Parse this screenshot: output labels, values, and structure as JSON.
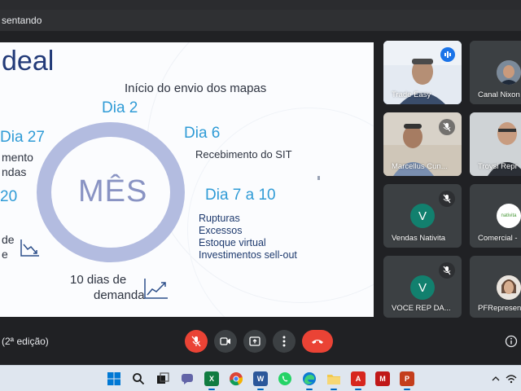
{
  "window": {
    "presenting_label": "sentando"
  },
  "slide": {
    "title": "deal",
    "circle_label": "MÊS",
    "items": {
      "dia2_label": "Dia 2",
      "dia2_text": "Início do envio dos mapas",
      "dia6_label": "Dia 6",
      "dia6_text": "Recebimento do SIT",
      "dia7_label": "Dia 7 a 10",
      "dia7_lines": [
        "Rupturas",
        "Excessos",
        "Estoque virtual",
        "Investimentos sell-out"
      ],
      "dia27_label": "Dia 27",
      "left_line1": "mento",
      "left_line2": "ndas",
      "left_day20": "20",
      "left_line3": "de",
      "left_line4": "e",
      "bottom_line1": "10 dias de",
      "bottom_line2": "demanda"
    }
  },
  "participants": [
    {
      "name": "Trade Easy",
      "speaking": true,
      "muted": false
    },
    {
      "name": "Canal Nixon",
      "speaking": false,
      "muted": false
    },
    {
      "name": "Marcellus Cun...",
      "speaking": false,
      "muted": true
    },
    {
      "name": "Troysi Repr",
      "speaking": false,
      "muted": false
    },
    {
      "name": "Vendas Nativita",
      "initial": "V",
      "speaking": false,
      "muted": true
    },
    {
      "name": "Comercial -",
      "speaking": false,
      "muted": false,
      "logo_text": "nativita"
    },
    {
      "name": "VOCE REP DA...",
      "initial": "V",
      "speaking": false,
      "muted": true
    },
    {
      "name": "PFRepresen",
      "speaking": false,
      "muted": false
    }
  ],
  "controls": {
    "meeting_name": "(2ª edição)"
  },
  "taskbar": {
    "apps": [
      "start-icon",
      "search-icon",
      "task-view-icon",
      "chat-icon",
      "excel-icon",
      "chrome-icon",
      "word-icon",
      "whatsapp-icon",
      "edge-icon",
      "file-explorer-icon",
      "acrobat-icon",
      "mcafee-icon",
      "powerpoint-icon"
    ]
  },
  "colors": {
    "accent": "#2f9bd6",
    "ring": "#b3bce0",
    "mic_off": "#ea4335",
    "avatar_teal": "#12806e"
  }
}
